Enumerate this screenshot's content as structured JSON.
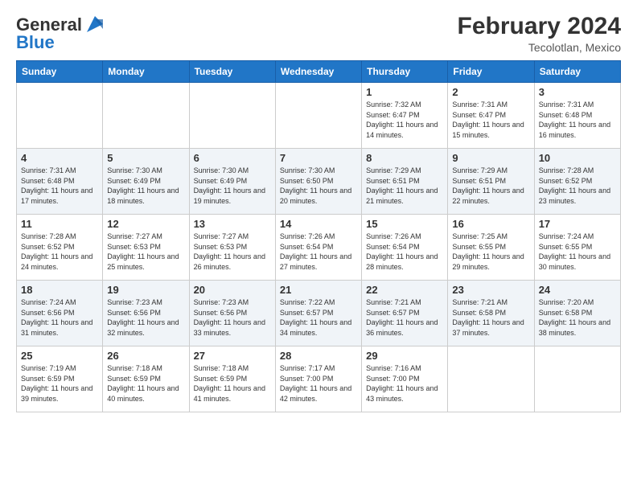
{
  "header": {
    "logo_general": "General",
    "logo_blue": "Blue",
    "month_title": "February 2024",
    "location": "Tecolotlan, Mexico"
  },
  "days_of_week": [
    "Sunday",
    "Monday",
    "Tuesday",
    "Wednesday",
    "Thursday",
    "Friday",
    "Saturday"
  ],
  "weeks": [
    [
      {
        "day": "",
        "info": ""
      },
      {
        "day": "",
        "info": ""
      },
      {
        "day": "",
        "info": ""
      },
      {
        "day": "",
        "info": ""
      },
      {
        "day": "1",
        "info": "Sunrise: 7:32 AM\nSunset: 6:47 PM\nDaylight: 11 hours and 14 minutes."
      },
      {
        "day": "2",
        "info": "Sunrise: 7:31 AM\nSunset: 6:47 PM\nDaylight: 11 hours and 15 minutes."
      },
      {
        "day": "3",
        "info": "Sunrise: 7:31 AM\nSunset: 6:48 PM\nDaylight: 11 hours and 16 minutes."
      }
    ],
    [
      {
        "day": "4",
        "info": "Sunrise: 7:31 AM\nSunset: 6:48 PM\nDaylight: 11 hours and 17 minutes."
      },
      {
        "day": "5",
        "info": "Sunrise: 7:30 AM\nSunset: 6:49 PM\nDaylight: 11 hours and 18 minutes."
      },
      {
        "day": "6",
        "info": "Sunrise: 7:30 AM\nSunset: 6:49 PM\nDaylight: 11 hours and 19 minutes."
      },
      {
        "day": "7",
        "info": "Sunrise: 7:30 AM\nSunset: 6:50 PM\nDaylight: 11 hours and 20 minutes."
      },
      {
        "day": "8",
        "info": "Sunrise: 7:29 AM\nSunset: 6:51 PM\nDaylight: 11 hours and 21 minutes."
      },
      {
        "day": "9",
        "info": "Sunrise: 7:29 AM\nSunset: 6:51 PM\nDaylight: 11 hours and 22 minutes."
      },
      {
        "day": "10",
        "info": "Sunrise: 7:28 AM\nSunset: 6:52 PM\nDaylight: 11 hours and 23 minutes."
      }
    ],
    [
      {
        "day": "11",
        "info": "Sunrise: 7:28 AM\nSunset: 6:52 PM\nDaylight: 11 hours and 24 minutes."
      },
      {
        "day": "12",
        "info": "Sunrise: 7:27 AM\nSunset: 6:53 PM\nDaylight: 11 hours and 25 minutes."
      },
      {
        "day": "13",
        "info": "Sunrise: 7:27 AM\nSunset: 6:53 PM\nDaylight: 11 hours and 26 minutes."
      },
      {
        "day": "14",
        "info": "Sunrise: 7:26 AM\nSunset: 6:54 PM\nDaylight: 11 hours and 27 minutes."
      },
      {
        "day": "15",
        "info": "Sunrise: 7:26 AM\nSunset: 6:54 PM\nDaylight: 11 hours and 28 minutes."
      },
      {
        "day": "16",
        "info": "Sunrise: 7:25 AM\nSunset: 6:55 PM\nDaylight: 11 hours and 29 minutes."
      },
      {
        "day": "17",
        "info": "Sunrise: 7:24 AM\nSunset: 6:55 PM\nDaylight: 11 hours and 30 minutes."
      }
    ],
    [
      {
        "day": "18",
        "info": "Sunrise: 7:24 AM\nSunset: 6:56 PM\nDaylight: 11 hours and 31 minutes."
      },
      {
        "day": "19",
        "info": "Sunrise: 7:23 AM\nSunset: 6:56 PM\nDaylight: 11 hours and 32 minutes."
      },
      {
        "day": "20",
        "info": "Sunrise: 7:23 AM\nSunset: 6:56 PM\nDaylight: 11 hours and 33 minutes."
      },
      {
        "day": "21",
        "info": "Sunrise: 7:22 AM\nSunset: 6:57 PM\nDaylight: 11 hours and 34 minutes."
      },
      {
        "day": "22",
        "info": "Sunrise: 7:21 AM\nSunset: 6:57 PM\nDaylight: 11 hours and 36 minutes."
      },
      {
        "day": "23",
        "info": "Sunrise: 7:21 AM\nSunset: 6:58 PM\nDaylight: 11 hours and 37 minutes."
      },
      {
        "day": "24",
        "info": "Sunrise: 7:20 AM\nSunset: 6:58 PM\nDaylight: 11 hours and 38 minutes."
      }
    ],
    [
      {
        "day": "25",
        "info": "Sunrise: 7:19 AM\nSunset: 6:59 PM\nDaylight: 11 hours and 39 minutes."
      },
      {
        "day": "26",
        "info": "Sunrise: 7:18 AM\nSunset: 6:59 PM\nDaylight: 11 hours and 40 minutes."
      },
      {
        "day": "27",
        "info": "Sunrise: 7:18 AM\nSunset: 6:59 PM\nDaylight: 11 hours and 41 minutes."
      },
      {
        "day": "28",
        "info": "Sunrise: 7:17 AM\nSunset: 7:00 PM\nDaylight: 11 hours and 42 minutes."
      },
      {
        "day": "29",
        "info": "Sunrise: 7:16 AM\nSunset: 7:00 PM\nDaylight: 11 hours and 43 minutes."
      },
      {
        "day": "",
        "info": ""
      },
      {
        "day": "",
        "info": ""
      }
    ]
  ]
}
